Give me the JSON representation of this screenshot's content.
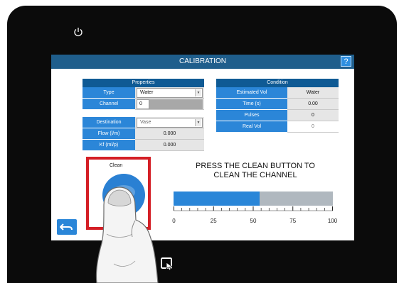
{
  "icons": {
    "power": "power-icon",
    "help": "help-icon",
    "back": "back-arrow-icon",
    "touch": "touch-screen-icon",
    "finger": "pointing-finger-icon"
  },
  "colors": {
    "titlebar": "#1f5e8c",
    "header": "#0f5a94",
    "label_cell": "#2b86d8",
    "accent": "#2a86d8",
    "highlight_frame": "#d41f26"
  },
  "window": {
    "title": "CALIBRATION",
    "help_label": "?"
  },
  "properties": {
    "header": "Properties",
    "rows": [
      {
        "label": "Type",
        "value": "Water"
      },
      {
        "label": "Channel",
        "value": "0"
      }
    ]
  },
  "destination_panel": {
    "rows": [
      {
        "label": "Destination",
        "value": "Vase"
      },
      {
        "label": "Flow (l/m)",
        "value": "0.000"
      },
      {
        "label": "Kf (ml/p)",
        "value": "0.000"
      }
    ]
  },
  "condition": {
    "header": "Condition",
    "rows": [
      {
        "label": "Estimated Vol",
        "value": "Water"
      },
      {
        "label": "Time (s)",
        "value": "0.00"
      },
      {
        "label": "Pulses",
        "value": "0"
      },
      {
        "label": "Real Vol",
        "value": "0"
      }
    ]
  },
  "clean": {
    "label": "Clean",
    "instruction_line1": "PRESS THE CLEAN BUTTON TO",
    "instruction_line2": "CLEAN THE CHANNEL"
  },
  "progress": {
    "percent": 54,
    "scale_labels": [
      "0",
      "25",
      "50",
      "75",
      "100"
    ]
  }
}
